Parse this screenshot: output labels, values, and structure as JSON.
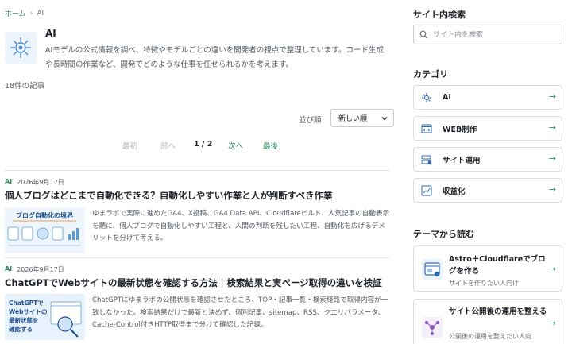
{
  "breadcrumb": {
    "home": "ホーム",
    "separator": "›",
    "current": "AI"
  },
  "category": {
    "title": "AI",
    "description": "AIモデルの公式情報を調べ、特徴やモデルごとの違いを開発者の視点で整理しています。コード生成や長時間の作業など、開発でどのような仕事を任せられるかを考えます。",
    "icon": "ai-sparkle-icon"
  },
  "count_text": "18件の記事",
  "sort": {
    "label": "並び順",
    "selected": "新しい順"
  },
  "pagination": {
    "first": "最初",
    "prev": "前へ",
    "current": "1 / 2",
    "next": "次へ",
    "last": "最後"
  },
  "articles": [
    {
      "category": "AI",
      "date": "2026年9月17日",
      "title": "個人ブログはどこまで自動化できる？自動化しやすい作業と人が判断すべき作業",
      "thumb_text": "ブログ自動化の境界",
      "excerpt": "ゆまラボで実際に進めたGA4、X投稿、GA4 Data API、Cloudflareビルド、人気記事の自動表示を題に、個人ブログで自動化しやすい工程と、人間の判断を残したい工程、自動化を広げるデメリットを分けて考える。"
    },
    {
      "category": "AI",
      "date": "2026年9月17日",
      "title": "ChatGPTでWebサイトの最新状態を確認する方法｜検索結果と実ページ取得の違いを検証",
      "thumb_line1": "ChatGPTで",
      "thumb_line2": "Webサイトの",
      "thumb_line3": "最新状態を",
      "thumb_line4": "確認する",
      "excerpt": "ChatGPTにゆまラボの公開状態を確認させたところ、TOP・記事一覧・検索経路で取得内容が一致しなかった。検索結果だけで最新と決めず、個別記事、sitemap、RSS、クエリパラメータ、Cache-Control付きHTTP取得まで分けて確認した記録。"
    }
  ],
  "sidebar": {
    "search_title": "サイト内検索",
    "search_placeholder": "サイト内を検索",
    "categories_title": "カテゴリ",
    "categories": [
      {
        "label": "AI",
        "icon": "ai-sparkle-icon"
      },
      {
        "label": "WEB制作",
        "icon": "code-window-icon"
      },
      {
        "label": "サイト運用",
        "icon": "server-icon"
      },
      {
        "label": "収益化",
        "icon": "chart-icon"
      }
    ],
    "themes_title": "テーマから読む",
    "themes": [
      {
        "title": "Astro＋Cloudflareでブログを作る",
        "sub": "サイトを作りたい人向け",
        "icon": "browser-window-icon"
      },
      {
        "title": "サイト公開後の運用を整える",
        "sub": "公開後の運用を整えたい人向",
        "icon": "share-network-icon"
      }
    ],
    "arrow": "→"
  },
  "colors": {
    "accent": "#2f8a5b",
    "icon_blue": "#2b6cb0",
    "border": "#d9dde1"
  }
}
